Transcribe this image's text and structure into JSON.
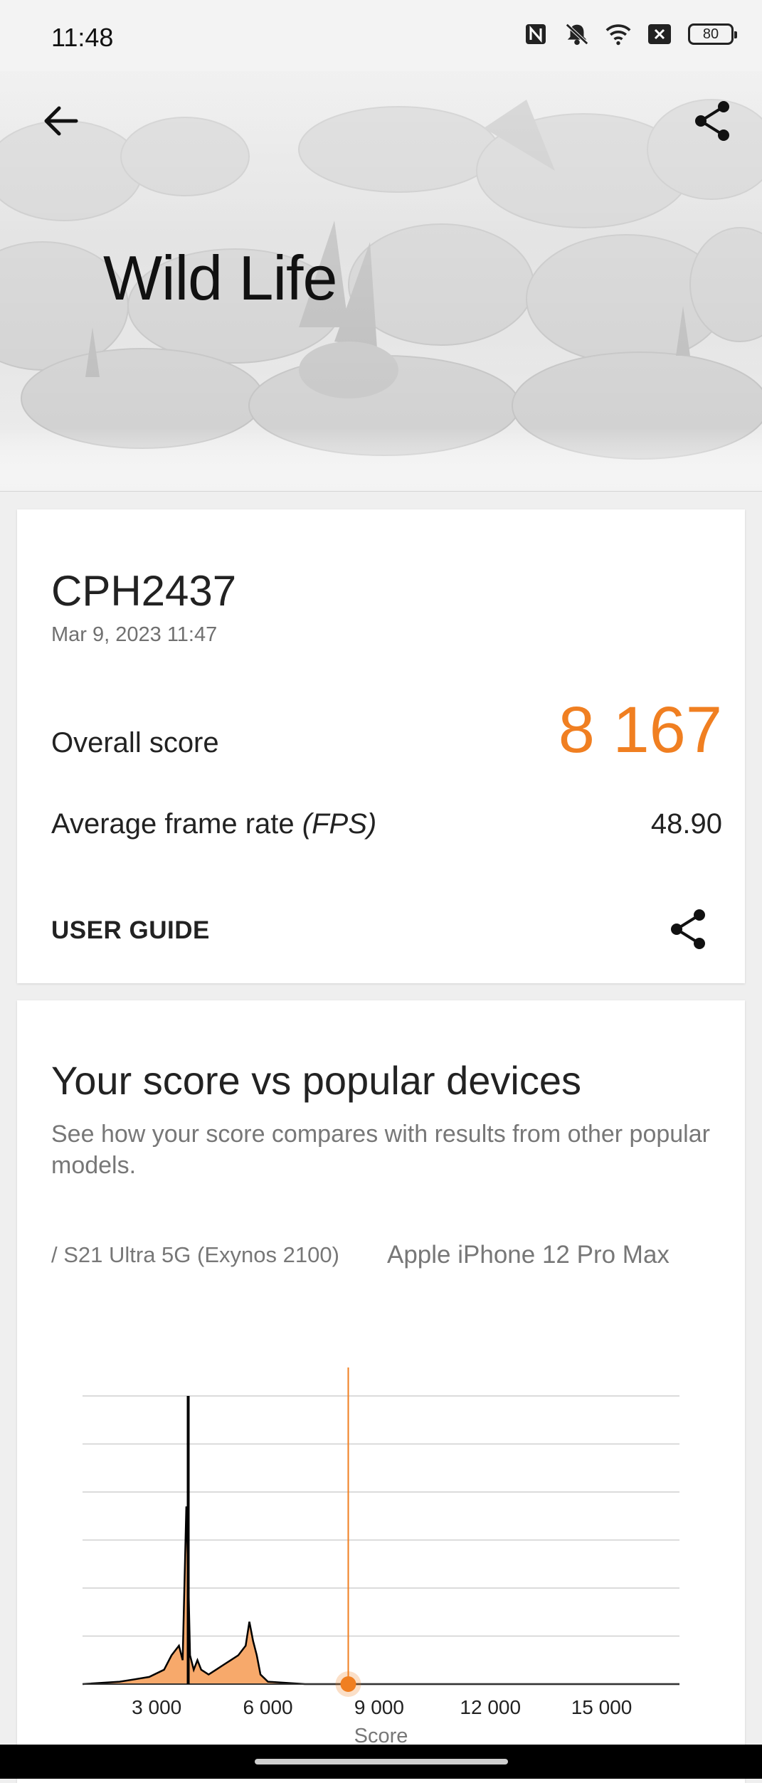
{
  "status_bar": {
    "time": "11:48",
    "battery": "80",
    "icons": [
      "nfc-icon",
      "mute-icon",
      "wifi-icon",
      "sim-off-icon",
      "battery-icon"
    ]
  },
  "header": {
    "title": "Wild Life",
    "back_icon": "arrow-left-icon",
    "share_icon": "share-icon"
  },
  "result": {
    "device": "CPH2437",
    "date": "Mar 9, 2023 11:47",
    "overall_label": "Overall score",
    "overall_value": "8 167",
    "fps_label_main": "Average frame rate ",
    "fps_label_unit": "(FPS)",
    "fps_value": "48.90",
    "guide_label": "USER GUIDE",
    "accent_color": "#f07f21"
  },
  "comparison": {
    "title": "Your score vs popular devices",
    "description": "See how your score compares with results from other popular models.",
    "devices": [
      "/ S21 Ultra 5G (Exynos 2100)",
      "Apple iPhone 12 Pro Max"
    ]
  },
  "chart_data": {
    "type": "area",
    "xlabel": "Score",
    "x_ticks": [
      "3 000",
      "6 000",
      "9 000",
      "12 000",
      "15 000"
    ],
    "x_tick_values": [
      3000,
      6000,
      9000,
      12000,
      15000
    ],
    "xlim": [
      1000,
      17100
    ],
    "ylim": [
      0,
      6
    ],
    "your_score": 8167,
    "distribution": {
      "x": [
        1000,
        2000,
        2400,
        2800,
        3200,
        3400,
        3600,
        3700,
        3800,
        3850,
        3900,
        4000,
        4100,
        4200,
        4400,
        4600,
        4800,
        5000,
        5200,
        5400,
        5500,
        5600,
        5700,
        5800,
        6000,
        7000,
        17100
      ],
      "y": [
        0,
        0.05,
        0.1,
        0.15,
        0.3,
        0.6,
        0.8,
        0.5,
        3.7,
        2.3,
        0.6,
        0.3,
        0.5,
        0.3,
        0.2,
        0.3,
        0.4,
        0.5,
        0.6,
        0.8,
        1.3,
        0.9,
        0.6,
        0.2,
        0.05,
        0,
        0
      ]
    },
    "popular_device_score": 3850,
    "popular_device_peak": 6,
    "grid": true,
    "colors": {
      "fill": "#f7a96b",
      "highlight": "#f07f21",
      "line": "#000000"
    }
  }
}
